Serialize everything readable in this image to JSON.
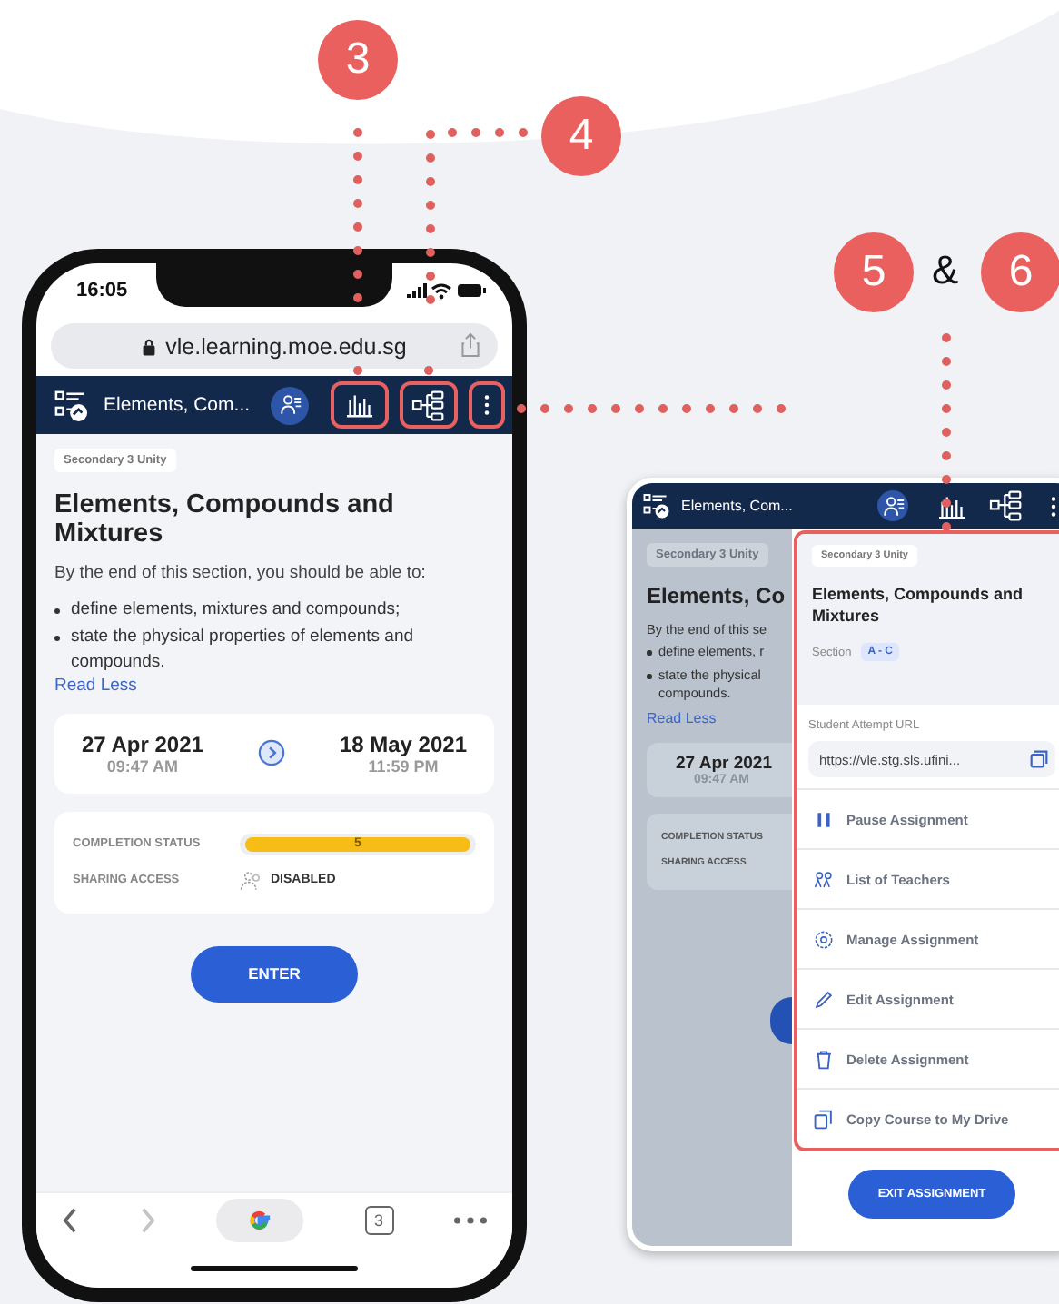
{
  "callouts": [
    {
      "kind": "badge",
      "label": "3"
    },
    {
      "kind": "badge",
      "label": "4"
    },
    {
      "kind": "badge",
      "label": "5"
    },
    {
      "kind": "joiner",
      "label": "&"
    },
    {
      "kind": "badge",
      "label": "6"
    }
  ],
  "phone": {
    "status_bar": {
      "time": "16:05"
    },
    "address_bar": {
      "url": "vle.learning.moe.edu.sg"
    },
    "app_bar": {
      "title": "Elements, Com...",
      "tools": [
        {
          "kind": "avatar",
          "highlighted": false
        },
        {
          "kind": "chart",
          "highlighted": true
        },
        {
          "kind": "tree",
          "highlighted": true
        },
        {
          "kind": "more",
          "highlighted": true
        }
      ]
    },
    "tag": "Secondary 3 Unity",
    "title": "Elements, Compounds and Mixtures",
    "intro": "By the end of this section, you should be able to:",
    "bullets": [
      "define elements, mixtures and compounds;",
      "state the physical properties of elements and compounds."
    ],
    "link": "Read Less",
    "schedule": {
      "start": {
        "date": "27 Apr 2021",
        "time": "09:47 AM"
      },
      "end": {
        "date": "18 May 2021",
        "time": "11:59 PM"
      }
    },
    "completion": {
      "label": "COMPLETION STATUS",
      "value": "5",
      "level": 1
    },
    "sharing": {
      "label": "SHARING ACCESS",
      "value": "DISABLED"
    },
    "enter_button": "ENTER",
    "browser_bar": {
      "tab_count": "3"
    }
  },
  "panel_phone": {
    "app_bar": {
      "title": "Elements, Com...",
      "tools": [
        {
          "kind": "avatar",
          "highlighted": false
        },
        {
          "kind": "chart",
          "highlighted": false
        },
        {
          "kind": "tree",
          "highlighted": false
        },
        {
          "kind": "more",
          "highlighted": false
        }
      ]
    },
    "background": {
      "tag": "Secondary 3 Unity",
      "title": "Elements, Co",
      "intro": "By the end of this se",
      "bullets": [
        {
          "lines": [
            "define elements, r"
          ]
        },
        {
          "lines": [
            "state the physical",
            "compounds."
          ]
        }
      ],
      "link": "Read Less",
      "start_date": "27 Apr 2021",
      "start_time": "09:47 AM",
      "completion_label": "COMPLETION STATUS",
      "sharing_label": "SHARING ACCESS"
    },
    "panel": {
      "highlighted": true,
      "tag": "Secondary 3 Unity",
      "title": "Elements, Compounds and Mixtures",
      "section_label": "Section",
      "section_value": "A - C",
      "url_label": "Student Attempt URL",
      "url_value": "https://vle.stg.sls.ufini...",
      "actions": [
        {
          "kind": "pause",
          "label": "Pause Assignment"
        },
        {
          "kind": "teachers",
          "label": "List of Teachers"
        },
        {
          "kind": "gear",
          "label": "Manage Assignment"
        },
        {
          "kind": "pencil",
          "label": "Edit Assignment"
        },
        {
          "kind": "trash",
          "label": "Delete Assignment"
        },
        {
          "kind": "copy",
          "label": "Copy Course to My Drive"
        }
      ],
      "exit_button": "EXIT ASSIGNMENT"
    }
  }
}
